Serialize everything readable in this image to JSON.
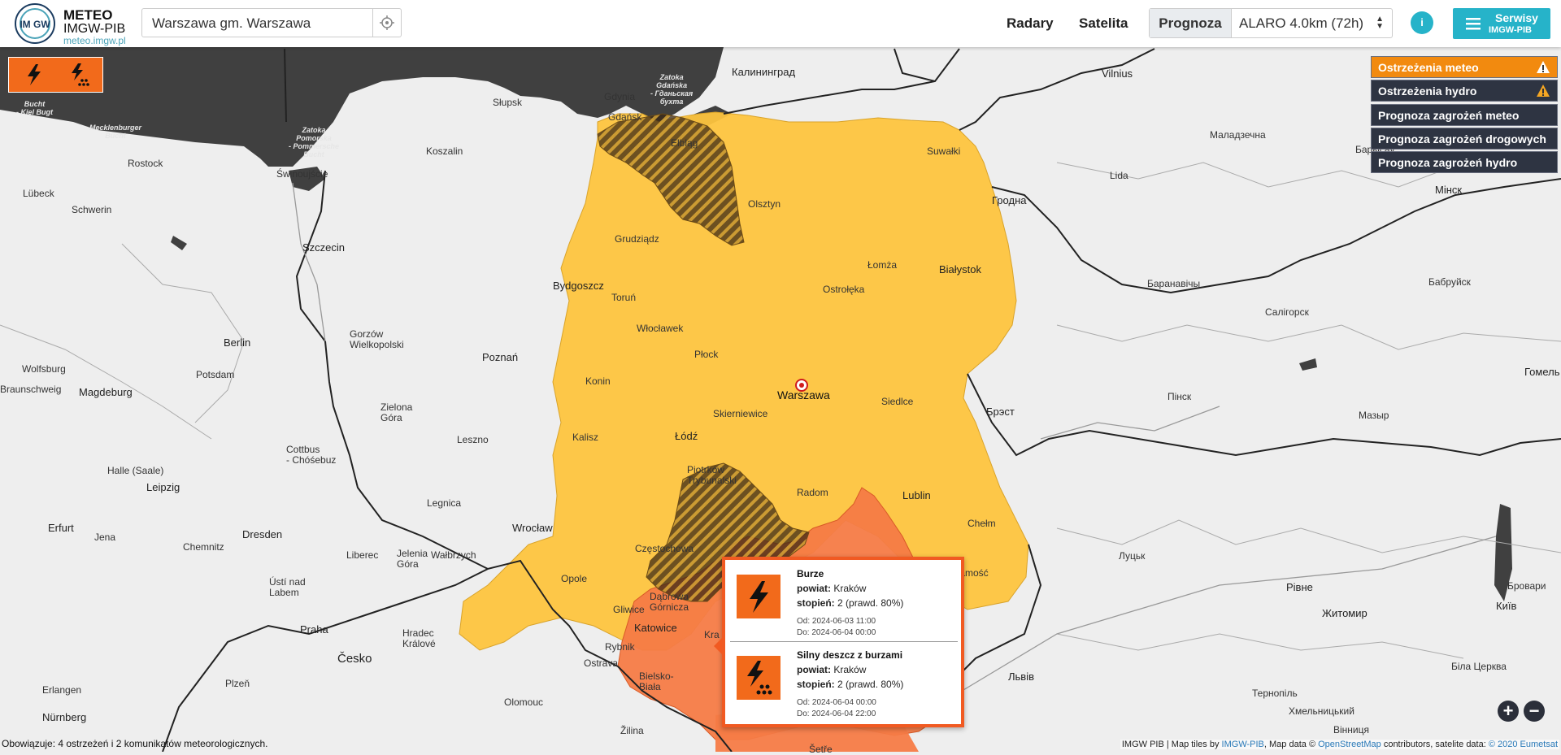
{
  "header": {
    "logo_title": "METEO",
    "logo_org": "IMGW-PIB",
    "logo_url": "meteo.imgw.pl",
    "logo_mark": "IM GW",
    "search_value": "Warszawa gm. Warszawa",
    "nav_radary": "Radary",
    "nav_satelita": "Satelita",
    "prognoza_label": "Prognoza",
    "prognoza_model": "ALARO 4.0km (72h)",
    "info_label": "i",
    "serwisy_t1": "Serwisy",
    "serwisy_t2": "IMGW-PIB"
  },
  "right_panel": {
    "items": [
      {
        "label": "Ostrzeżenia meteo"
      },
      {
        "label": "Ostrzeżenia hydro"
      },
      {
        "label": "Prognoza zagrożeń meteo"
      },
      {
        "label": "Prognoza zagrożeń drogowych"
      },
      {
        "label": "Prognoza zagrożeń hydro"
      }
    ]
  },
  "popup": {
    "warnings": [
      {
        "title": "Burze",
        "powiat_label": "powiat:",
        "powiat": "Kraków",
        "stopien_label": "stopień:",
        "stopien": "2 (prawd. 80%)",
        "od_label": "Od:",
        "od": "2024-06-03 11:00",
        "do_label": "Do:",
        "do": "2024-06-04 00:00"
      },
      {
        "title": "Silny deszcz z burzami",
        "powiat_label": "powiat:",
        "powiat": "Kraków",
        "stopien_label": "stopień:",
        "stopien": "2 (prawd. 80%)",
        "od_label": "Od:",
        "od": "2024-06-04 00:00",
        "do_label": "Do:",
        "do": "2024-06-04 22:00"
      }
    ]
  },
  "status_text": "Obowiązuje: 4 ostrzeżeń i 2 komunikatów meteorologicznych.",
  "attribution": {
    "prefix": "IMGW PIB | Map tiles by ",
    "tiles_link": "IMGW-PIB",
    "mid": ", Map data © ",
    "osm_link": "OpenStreetMap",
    "mid2": " contributors, satelite data: ",
    "eumetsat_link": "© 2020 Eumetsat"
  },
  "zoom": {
    "in": "+",
    "out": "−"
  },
  "colors": {
    "warning_level1": "#fdc43e",
    "warning_level2": "#f57b46",
    "sea": "#404040",
    "accent": "#26b3c9",
    "warning_icon_bg": "#f26a1b"
  },
  "icons": {
    "thunder": "lightning-icon",
    "rain_thunder": "rain-lightning-icon"
  },
  "cities": [
    {
      "name": "Gdańsk"
    },
    {
      "name": "Gdynia"
    },
    {
      "name": "Słupsk"
    },
    {
      "name": "Koszalin"
    },
    {
      "name": "Elbląg"
    },
    {
      "name": "Olsztyn"
    },
    {
      "name": "Suwałki"
    },
    {
      "name": "Świnoujście"
    },
    {
      "name": "Szczecin"
    },
    {
      "name": "Grudziądz"
    },
    {
      "name": "Bydgoszcz"
    },
    {
      "name": "Toruń"
    },
    {
      "name": "Łomża"
    },
    {
      "name": "Białystok"
    },
    {
      "name": "Ostrołęka"
    },
    {
      "name": "Włocławek"
    },
    {
      "name": "Płock"
    },
    {
      "name": "Poznań"
    },
    {
      "name": "Konin"
    },
    {
      "name": "Warszawa"
    },
    {
      "name": "Siedlce"
    },
    {
      "name": "Skierniewice"
    },
    {
      "name": "Kalisz"
    },
    {
      "name": "Łódź"
    },
    {
      "name": "Leszno"
    },
    {
      "name": "Zielona\nGóra"
    },
    {
      "name": "Gorzów\nWielkopolski"
    },
    {
      "name": "Piotrków\nTrybunalski"
    },
    {
      "name": "Radom"
    },
    {
      "name": "Lublin"
    },
    {
      "name": "Chełm"
    },
    {
      "name": "Legnica"
    },
    {
      "name": "Wrocław"
    },
    {
      "name": "Częstochowa"
    },
    {
      "name": "Opole"
    },
    {
      "name": "Jelenia\nGóra"
    },
    {
      "name": "Wałbrzych"
    },
    {
      "name": "Dąbrowa\nGórnicza"
    },
    {
      "name": "Gliwice"
    },
    {
      "name": "Katowice"
    },
    {
      "name": "Kra"
    },
    {
      "name": "Rybnik"
    },
    {
      "name": "Ostrava"
    },
    {
      "name": "Bielsko-\nBiała"
    },
    {
      "name": "Zamość"
    },
    {
      "name": "Rostock"
    },
    {
      "name": "Lübeck"
    },
    {
      "name": "Schwerin"
    },
    {
      "name": "Berlin"
    },
    {
      "name": "Potsdam"
    },
    {
      "name": "Wolfsburg"
    },
    {
      "name": "Braunschweig"
    },
    {
      "name": "Magdeburg"
    },
    {
      "name": "Halle (Saale)"
    },
    {
      "name": "Leipzig"
    },
    {
      "name": "Cottbus\n- Chóśebuz"
    },
    {
      "name": "Dresden"
    },
    {
      "name": "Chemnitz"
    },
    {
      "name": "Erfurt"
    },
    {
      "name": "Jena"
    },
    {
      "name": "Liberec"
    },
    {
      "name": "Ústí nad\nLabem"
    },
    {
      "name": "Praha"
    },
    {
      "name": "Hradec\nKrálové"
    },
    {
      "name": "Česko"
    },
    {
      "name": "Plzeň"
    },
    {
      "name": "Olomouc"
    },
    {
      "name": "Erlangen"
    },
    {
      "name": "Nürnberg"
    },
    {
      "name": "Žilina"
    },
    {
      "name": "Калининград"
    },
    {
      "name": "Vilnius"
    },
    {
      "name": "Lida"
    },
    {
      "name": "Гродна"
    },
    {
      "name": "Маладзечна"
    },
    {
      "name": "Барысаў"
    },
    {
      "name": "Мінск"
    },
    {
      "name": "Бабруйск"
    },
    {
      "name": "Баранавічы"
    },
    {
      "name": "Салігорск"
    },
    {
      "name": "Гомель"
    },
    {
      "name": "Пінск"
    },
    {
      "name": "Мазыр"
    },
    {
      "name": "Брэст"
    },
    {
      "name": "Луцьк"
    },
    {
      "name": "Рівне"
    },
    {
      "name": "Житомир"
    },
    {
      "name": "Київ"
    },
    {
      "name": "Бровари"
    },
    {
      "name": "Біла Церква"
    },
    {
      "name": "Львів"
    },
    {
      "name": "Тернопіль"
    },
    {
      "name": "Хмельницький"
    },
    {
      "name": "Вінниця"
    },
    {
      "name": "Šetře"
    },
    {
      "name": "Bucht\n- Kiel Bugt"
    },
    {
      "name": "Mecklenburger\nBucht"
    },
    {
      "name": "Zatoka\nPomorska\n- Pommersche\nBucht"
    },
    {
      "name": "Zatoka\nGdańska\n- Гданьская\nбухта"
    }
  ]
}
